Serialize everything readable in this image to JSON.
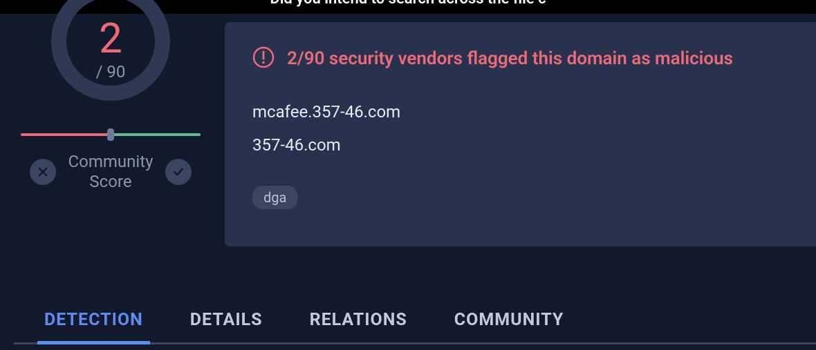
{
  "banner": {
    "text": "Did you intend to search across the file c"
  },
  "score": {
    "value": "2",
    "total": "/ 90"
  },
  "community": {
    "label_line1": "Community",
    "label_line2": "Score"
  },
  "warning": {
    "text": "2/90 security vendors flagged this domain as malicious"
  },
  "domains": {
    "full": "mcafee.357-46.com",
    "root": "357-46.com"
  },
  "tags": [
    "dga"
  ],
  "tabs": [
    {
      "label": "DETECTION",
      "active": true
    },
    {
      "label": "DETAILS",
      "active": false
    },
    {
      "label": "RELATIONS",
      "active": false
    },
    {
      "label": "COMMUNITY",
      "active": false
    }
  ]
}
